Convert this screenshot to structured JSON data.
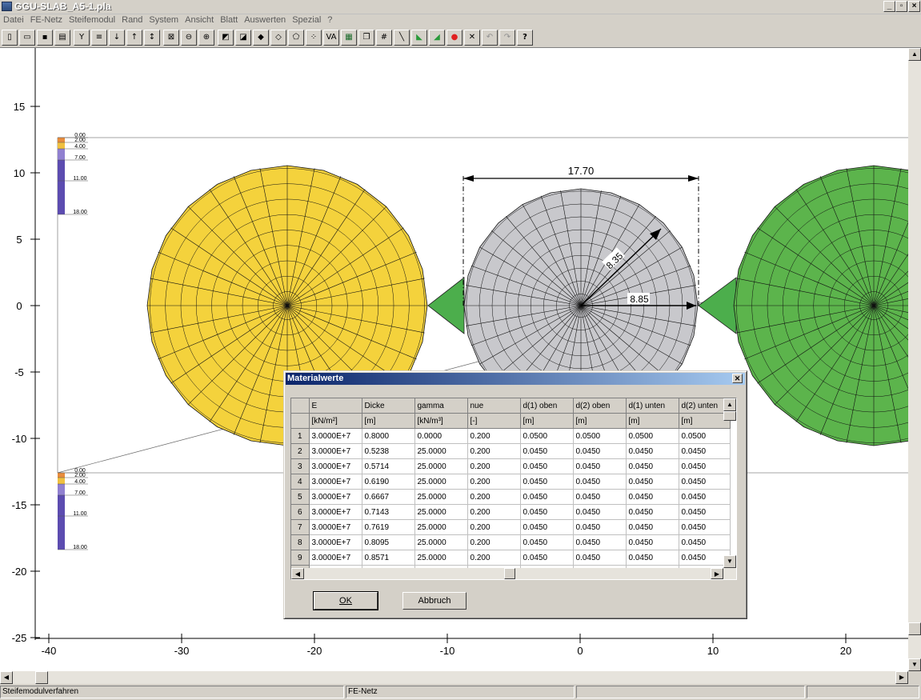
{
  "window": {
    "title": "GGU-SLAB_A5-1.pla",
    "controls": [
      "_",
      "▫",
      "×"
    ]
  },
  "menu": [
    "Datei",
    "FE-Netz",
    "Steifemodul",
    "Rand",
    "System",
    "Ansicht",
    "Blatt",
    "Auswerten",
    "Spezial",
    "?"
  ],
  "toolbar": {
    "icons": [
      "new-file-icon",
      "open-folder-icon",
      "save-disk-icon",
      "print-icon",
      "filter-icon",
      "list-icon",
      "arrow-down-icon",
      "arrow-up-icon",
      "arrow-updown-icon",
      "zoom-page-icon",
      "zoom-out-icon",
      "zoom-in-icon",
      "tool-a-icon",
      "tool-b-icon",
      "tool-c-icon",
      "tool-d-icon",
      "polygon-icon",
      "points-icon",
      "va-icon",
      "table-icon",
      "copy-icon",
      "grid-icon",
      "line-icon",
      "color-map-icon",
      "color-map2-icon",
      "red-circle-icon",
      "cross-icon",
      "undo-icon",
      "redo-icon",
      "help-icon"
    ],
    "va_label": "VA",
    "help_label": "?"
  },
  "plot": {
    "y_ticks": [
      "15",
      "10",
      "5",
      "0",
      "-5",
      "-10",
      "-15",
      "-20",
      "-25"
    ],
    "x_ticks": [
      "-40",
      "-30",
      "-20",
      "-10",
      "0",
      "10",
      "20"
    ],
    "legend_labels": [
      "0.00",
      "2.00",
      "4.00",
      "7.00",
      "11.00",
      "18.00"
    ],
    "legend_colors": [
      "#ffffff",
      "#f0a030",
      "#f0e060",
      "#8a7ac8",
      "#4030a0",
      "#4030a0"
    ],
    "dim_width": "17.70",
    "dim_r1": "8.35",
    "dim_r2": "8.85",
    "colors": {
      "yellow": "#f4d23c",
      "navy": "#3c3ca8",
      "cyan": "#4ec6dc",
      "teal": "#3aa6a0",
      "green": "#5cb44c",
      "lightgreen": "#8cc83c",
      "orange": "#f08c28",
      "red": "#d83c28",
      "gray": "#c8c8cc"
    }
  },
  "status": {
    "left": "Steifemodulverfahren",
    "mid": "FE-Netz"
  },
  "dialog": {
    "title": "Materialwerte",
    "columns": [
      {
        "name": "E",
        "unit": "[kN/m²]"
      },
      {
        "name": "Dicke",
        "unit": "[m]"
      },
      {
        "name": "gamma",
        "unit": "[kN/m³]"
      },
      {
        "name": "nue",
        "unit": "[-]"
      },
      {
        "name": "d(1) oben",
        "unit": "[m]"
      },
      {
        "name": "d(2) oben",
        "unit": "[m]"
      },
      {
        "name": "d(1) unten",
        "unit": "[m]"
      },
      {
        "name": "d(2) unten",
        "unit": "[m]"
      }
    ],
    "rows": [
      [
        "1",
        "3.0000E+7",
        "0.8000",
        "0.0000",
        "0.200",
        "0.0500",
        "0.0500",
        "0.0500",
        "0.0500"
      ],
      [
        "2",
        "3.0000E+7",
        "0.5238",
        "25.0000",
        "0.200",
        "0.0450",
        "0.0450",
        "0.0450",
        "0.0450"
      ],
      [
        "3",
        "3.0000E+7",
        "0.5714",
        "25.0000",
        "0.200",
        "0.0450",
        "0.0450",
        "0.0450",
        "0.0450"
      ],
      [
        "4",
        "3.0000E+7",
        "0.6190",
        "25.0000",
        "0.200",
        "0.0450",
        "0.0450",
        "0.0450",
        "0.0450"
      ],
      [
        "5",
        "3.0000E+7",
        "0.6667",
        "25.0000",
        "0.200",
        "0.0450",
        "0.0450",
        "0.0450",
        "0.0450"
      ],
      [
        "6",
        "3.0000E+7",
        "0.7143",
        "25.0000",
        "0.200",
        "0.0450",
        "0.0450",
        "0.0450",
        "0.0450"
      ],
      [
        "7",
        "3.0000E+7",
        "0.7619",
        "25.0000",
        "0.200",
        "0.0450",
        "0.0450",
        "0.0450",
        "0.0450"
      ],
      [
        "8",
        "3.0000E+7",
        "0.8095",
        "25.0000",
        "0.200",
        "0.0450",
        "0.0450",
        "0.0450",
        "0.0450"
      ],
      [
        "9",
        "3.0000E+7",
        "0.8571",
        "25.0000",
        "0.200",
        "0.0450",
        "0.0450",
        "0.0450",
        "0.0450"
      ]
    ],
    "ok_label": "OK",
    "cancel_label": "Abbruch"
  }
}
